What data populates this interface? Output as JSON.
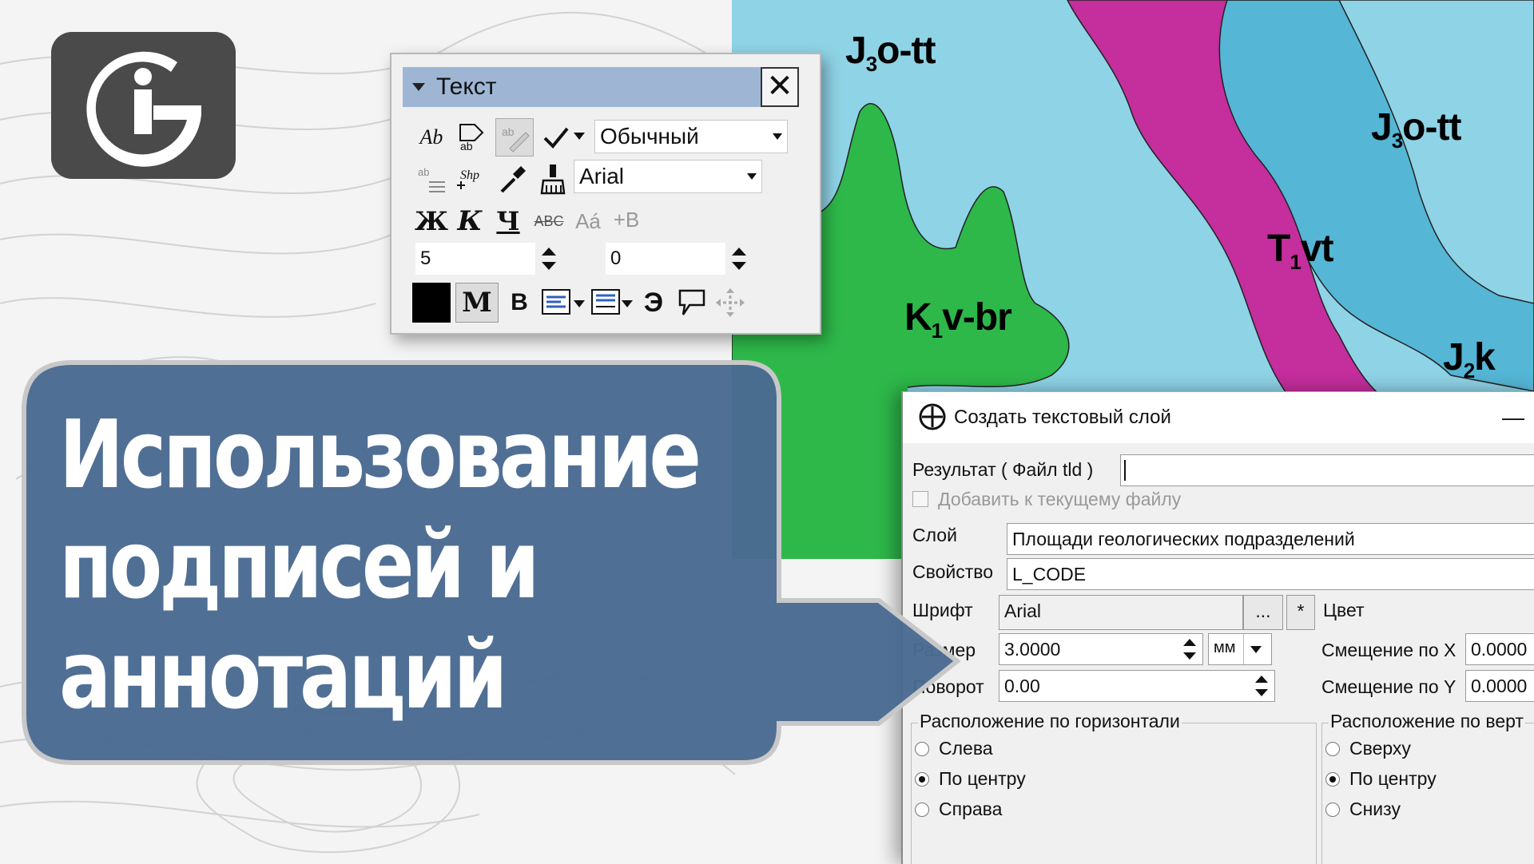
{
  "colors": {
    "banner": "#4a6a92",
    "map_light": "#8fd3e6",
    "map_mid": "#55b6d6",
    "map_magenta": "#c42e9d",
    "map_green": "#2eb84a",
    "logo_bg": "#4a4a4a"
  },
  "logo": {
    "name": "GIS-logo"
  },
  "headline": {
    "line1": "Использование",
    "line2": "подписей и",
    "line3": "аннотаций"
  },
  "map": {
    "labels": [
      {
        "base": "J",
        "sub": "3",
        "rest": "o-tt"
      },
      {
        "base": "J",
        "sub": "3",
        "rest": "o-tt"
      },
      {
        "base": "T",
        "sub": "1",
        "rest": "vt"
      },
      {
        "base": "K",
        "sub": "1",
        "rest": "v-br"
      },
      {
        "base": "J",
        "sub": "2",
        "rest": "k"
      }
    ]
  },
  "text_toolbar": {
    "title": "Текст",
    "style_combo": "Обычный",
    "font_combo": "Arial",
    "bold_label": "Ж",
    "italic_label": "К",
    "underline_label": "Ч",
    "strike_label": "ABC",
    "case_label": "Aá",
    "offset_label": "+B",
    "size_value": "5",
    "angle_value": "0",
    "m_label": "M",
    "b_label": "B",
    "e_label": "Э",
    "icons": [
      "text-style-icon",
      "text-edit-icon",
      "text-tool-icon",
      "check-icon",
      "text-list-icon",
      "shape-text-icon",
      "eyedropper-icon",
      "brush-icon",
      "align-left-icon",
      "align-center-icon",
      "callout-icon",
      "move-icon"
    ]
  },
  "dialog": {
    "title": "Создать текстовый слой",
    "minimize": "—",
    "result_label": "Результат ( Файл tld )",
    "result_value": "",
    "append_label": "Добавить к текущему файлу",
    "layer_label": "Слой",
    "layer_value": "Площади геологических подразделений",
    "property_label": "Свойство",
    "property_value": "L_CODE",
    "font_label": "Шрифт",
    "font_value": "Arial",
    "font_btn": "...",
    "font_star": "*",
    "color_label": "Цвет",
    "size_label": "Размер",
    "size_value": "3.0000",
    "unit_value": "мм",
    "offset_x_label": "Смещение по X",
    "offset_x_value": "0.0000",
    "rotate_label": "Поворот",
    "rotate_value": "0.00",
    "offset_y_label": "Смещение по Y",
    "offset_y_value": "0.0000",
    "h_group_label": "Расположение по горизонтали",
    "h_options": [
      "Слева",
      "По центру",
      "Справа"
    ],
    "h_selected": 1,
    "v_group_label": "Расположение по верт",
    "v_options": [
      "Сверху",
      "По центру",
      "Снизу"
    ],
    "v_selected": 1
  }
}
